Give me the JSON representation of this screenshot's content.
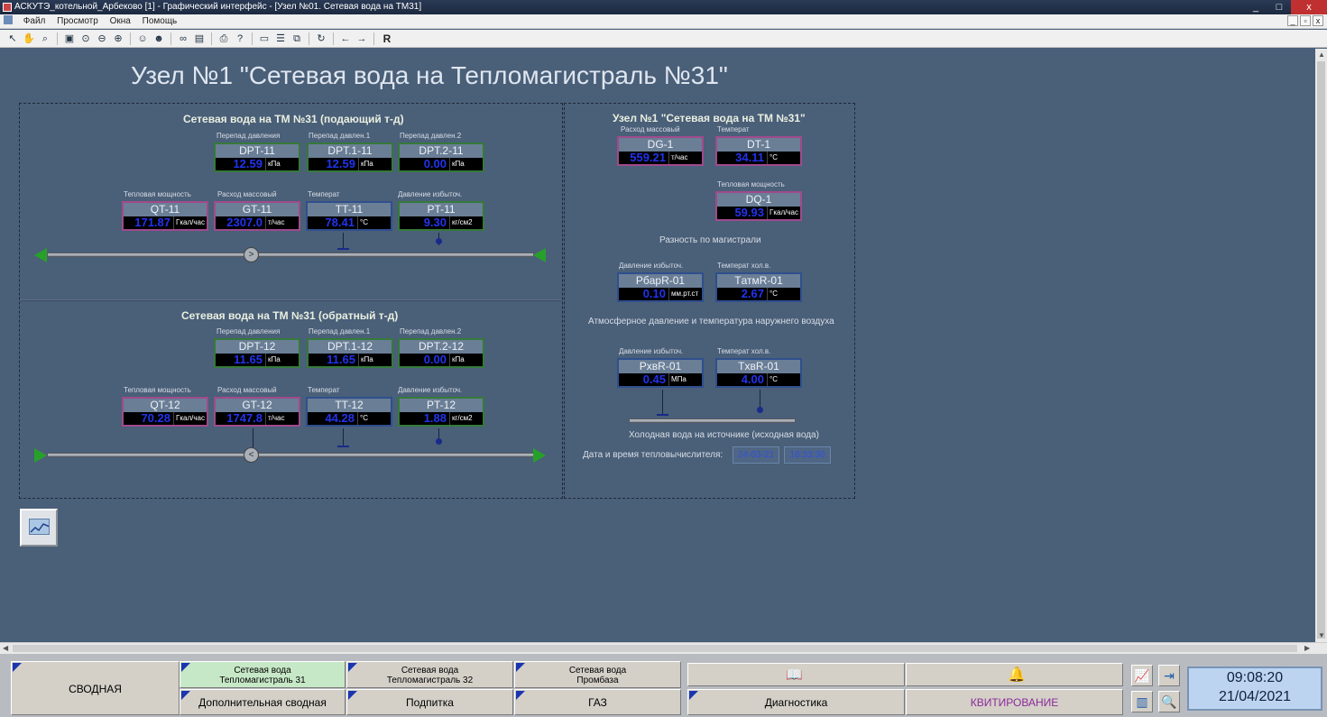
{
  "window": {
    "title": "АСКУТЭ_котельной_Арбеково [1] - Графический интерфейс - [Узел №01. Сетевая вода на ТМ31]",
    "controls": {
      "minimize": "_",
      "maximize": "□",
      "close": "x"
    },
    "mdi_controls": {
      "minimize": "_",
      "restore": "▫",
      "close": "x"
    }
  },
  "menu": [
    "Файл",
    "Просмотр",
    "Окна",
    "Помощь"
  ],
  "toolbar": {
    "r_label": "R"
  },
  "page": {
    "title": "Узел №1 \"Сетевая вода на Тепломагистраль №31\""
  },
  "supply": {
    "title": "Сетевая вода на ТМ №31 (подающий т-д)",
    "caps": {
      "dpt": "Перепад давления",
      "dpt1": "Перепад давлен.1",
      "dpt2": "Перепад давлен.2",
      "qt": "Тепловая мощность",
      "gt": "Расход массовый",
      "tt": "Температ",
      "pt": "Давление избыточ."
    },
    "tags": {
      "dpt": {
        "name": "DPT-11",
        "value": "12.59",
        "unit": "кПа"
      },
      "dpt1": {
        "name": "DPT.1-11",
        "value": "12.59",
        "unit": "кПа"
      },
      "dpt2": {
        "name": "DPT.2-11",
        "value": "0.00",
        "unit": "кПа"
      },
      "qt": {
        "name": "QT-11",
        "value": "171.87",
        "unit": "Гкал/час"
      },
      "gt": {
        "name": "GT-11",
        "value": "2307.0",
        "unit": "т/час"
      },
      "tt": {
        "name": "TT-11",
        "value": "78.41",
        "unit": "°C"
      },
      "pt": {
        "name": "PT-11",
        "value": "9.30",
        "unit": "кг/см2"
      }
    }
  },
  "return": {
    "title": "Сетевая вода на ТМ №31 (обратный т-д)",
    "caps": {
      "dpt": "Перепад давления",
      "dpt1": "Перепад давлен.1",
      "dpt2": "Перепад давлен.2",
      "qt": "Тепловая мощность",
      "gt": "Расход массовый",
      "tt": "Температ",
      "pt": "Давление избыточ."
    },
    "tags": {
      "dpt": {
        "name": "DPT-12",
        "value": "11.65",
        "unit": "кПа"
      },
      "dpt1": {
        "name": "DPT.1-12",
        "value": "11.65",
        "unit": "кПа"
      },
      "dpt2": {
        "name": "DPT.2-12",
        "value": "0.00",
        "unit": "кПа"
      },
      "qt": {
        "name": "QT-12",
        "value": "70.28",
        "unit": "Гкал/час"
      },
      "gt": {
        "name": "GT-12",
        "value": "1747.8",
        "unit": "т/час"
      },
      "tt": {
        "name": "TT-12",
        "value": "44.28",
        "unit": "°C"
      },
      "pt": {
        "name": "PT-12",
        "value": "1.88",
        "unit": "кг/см2"
      }
    }
  },
  "node": {
    "title": "Узел №1 \"Сетевая вода на ТМ №31\"",
    "caps": {
      "dg": "Расход массовый",
      "dt": "Температ",
      "dq": "Тепловая мощность"
    },
    "tags": {
      "dg": {
        "name": "DG-1",
        "value": "559.21",
        "unit": "т/час"
      },
      "dt": {
        "name": "DT-1",
        "value": "34.11",
        "unit": "°C"
      },
      "dq": {
        "name": "DQ-1",
        "value": "59.93",
        "unit": "Гкал/час"
      }
    },
    "diff_label": "Разность по магистрали",
    "atm_caps": {
      "p": "Давление избыточ.",
      "t": "Температ хол.в."
    },
    "atm_tags": {
      "p": {
        "name": "PбapR-01",
        "value": "0.10",
        "unit": "мм.рт.ст"
      },
      "t": {
        "name": "TатмR-01",
        "value": "2.67",
        "unit": "°C"
      }
    },
    "atm_label": "Атмосферное давление и температура наружнего воздуха",
    "cold_caps": {
      "p": "Давление избыточ.",
      "t": "Температ хол.в."
    },
    "cold_tags": {
      "p": {
        "name": "PхвR-01",
        "value": "0.45",
        "unit": "МПа"
      },
      "t": {
        "name": "TхвR-01",
        "value": "4.00",
        "unit": "°C"
      }
    },
    "cold_label": "Холодная вода на источнике (исходная вода)",
    "datetime_label": "Дата и время тепловычислителя:",
    "date": "24-03-21",
    "time": "16:33:30"
  },
  "nav": {
    "summary": "СВОДНАЯ",
    "tm31": {
      "l1": "Сетевая вода",
      "l2": "Тепломагистраль 31"
    },
    "tm32": {
      "l1": "Сетевая вода",
      "l2": "Тепломагистраль 32"
    },
    "prombaza": {
      "l1": "Сетевая вода",
      "l2": "Промбаза"
    },
    "extra_summary": "Дополнительная сводная",
    "podpitka": "Подпитка",
    "gaz": "ГАЗ",
    "diagnostics": "Диагностика",
    "acknowledge": "КВИТИРОВАНИЕ",
    "colors": {
      "active": "#c7e8c7",
      "acknowledge_text": "#8b2a9a"
    }
  },
  "clock": {
    "time": "09:08:20",
    "date": "21/04/2021"
  }
}
